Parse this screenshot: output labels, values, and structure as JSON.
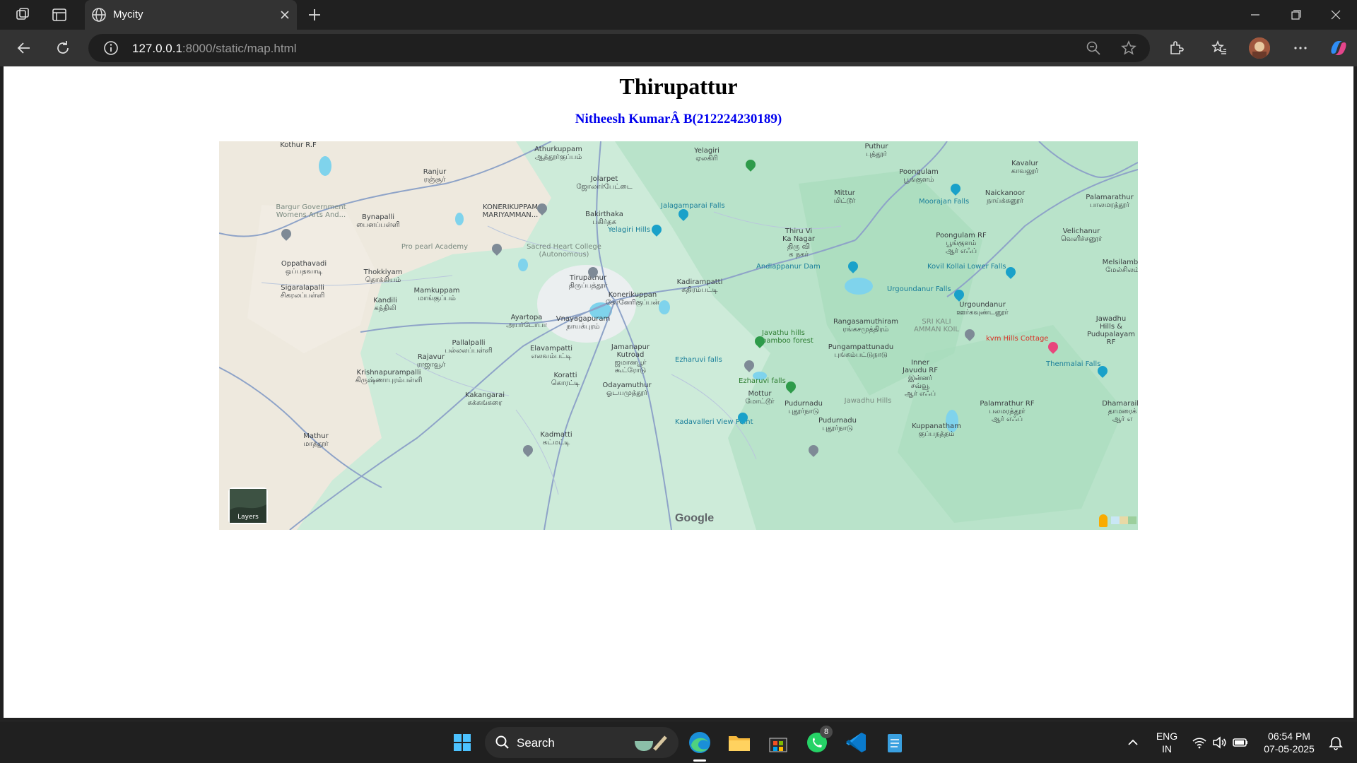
{
  "browser": {
    "tab_title": "Mycity",
    "url_host": "127.0.0.1",
    "url_rest": ":8000/static/map.html"
  },
  "page": {
    "title": "Thirupattur",
    "subtitle": "Nitheesh KumarÂ B(212224230189)"
  },
  "map": {
    "layers_label": "Layers",
    "google_label": "Google",
    "labels": {
      "kothur": "Kothur R.F",
      "athurkuppam": "Athurkuppam\nஆத்தூர்குப்பம்",
      "ranjur": "Ranjur\nரஞ்சூர்",
      "jolarpet": "Jolarpet\nஜோலார்பேட்டை",
      "yelagiri": "Yelagiri\nஏலகிரி",
      "puthur": "Puthur\nபுத்தூர்",
      "kavalur": "Kavalur\nகாவலூர்",
      "poongulam": "Poongulam\nபூங்குளம்",
      "naickanoor": "Naickanoor\nநாய்க்கனூர்",
      "palamarathur": "Palamarathur\nபாலமரத்தூர்",
      "bargur": "Bargur Government\nWomens Arts And...",
      "bynapalli": "Bynapalli\nபைனப்பள்ளி",
      "konerikuppam_m": "KONERIKUPPAM\nMARIYAMMAN...",
      "bakirthaka": "Bakirthaka\nபகிர்தக",
      "jalagamparai": "Jalagamparai Falls",
      "mittur": "Mittur\nமிட்டூர்",
      "moorajan": "Moorajan Falls",
      "yelagiri_hills": "Yelagiri Hills",
      "thiru_vi": "Thiru Vi\nKa Nagar\nதிரு வி\nக நகர்",
      "poongulam_rf": "Poongulam RF\nபூங்குளம்\nஆர் எஃப்",
      "velichanur": "Velichanur\nவெளிச்சனூர்",
      "pro_pearl": "Pro pearl Academy",
      "sacred_heart": "Sacred Heart College\n(Autonomous)",
      "oppathavadi": "Oppathavadi\nஒப்பதவாடி",
      "thokkiyam": "Thokkiyam\nதொக்கியம்",
      "andiappanur": "Andiappanur Dam",
      "kovil_kollai": "Kovil Kollai Lower Falls",
      "melsilamba": "Melsilamba\nமேல்சிலம்",
      "tirupathur": "Tirupathur\nதிருப்பத்தூர்",
      "kadirampatti": "Kadirampatti\nகதிரம்பட்டி",
      "sigaralapalli": "Sigaralapalli\nசிகரலப்பள்ளி",
      "mamkuppam": "Mamkuppam\nமாங்குப்பம்",
      "konerikuppan": "Konerikuppan\nகோனேரிகுப்பன்",
      "urgoundanur_falls": "Urgoundanur Falls",
      "kandili": "Kandili\nகந்திலி",
      "urgoundanur": "Urgoundanur\nஊர்கவுண்டனூர்",
      "ayartopa": "Ayartopa\nஅயர்டோபா",
      "vnayagapuram": "Vnayagapuram\nநாயக்புரம்",
      "rangasamuthiram": "Rangasamuthiram\nரங்கசமுத்திரம்",
      "sri_kali": "SRI KALI\nAMMAN KOIL",
      "jawadhu_rf": "Jawadhu\nHills &\nPudupalayam\nRF",
      "javathu_bamboo": "Javathu hills\nbamboo forest",
      "kvm_hills": "kvm Hills Cottage",
      "pallalpalli": "Pallalpalli\nபல்லலப்பள்ளி",
      "elavampatti": "Elavampatti\nஎலவம்பட்டி",
      "jamanapur": "Jamanapur\nKutroad\nஜமானபூர்\nகூட்ரோடு",
      "pungampattunadu": "Pungampattunadu\nபுங்கம்பட்டுநாடு",
      "rajavur": "Rajavur\nராஜாவூர்",
      "ezharuvi_falls": "Ezharuvi falls",
      "inner_javadu": "Inner\nJavudu RF\nஇன்னர்\nசவ்வூ\nஆர் எஃப்",
      "thenmalai": "Thenmalai Falls",
      "krishnapurampalli": "Krishnapurampalli\nகிருஷ்ணாபுரம்பள்ளி",
      "koratti": "Koratti\nகொரட்டி",
      "ezharuvi_falls2": "Ezharuvi falls",
      "odayamuthur": "Odayamuthur\nஓடயமுத்தூர்",
      "kakangarai": "Kakangarai\nகக்கங்கரை",
      "mottur": "Mottur\nமோட்டூர்",
      "pudurnadu": "Pudurnadu\nபுதூர்நாடு",
      "jawadhu_hills": "Jawadhu Hills",
      "palamrathur_rf": "Palamrathur RF\nபலமரத்தூர்\nஆர் எஃப்",
      "dhamaraikl": "Dhamaraikl\nதாமரைக்\nஆர் எ",
      "kadavalleri": "Kadavalleri View Point",
      "pudurnadu2": "Pudurnadu\nபுதூர்நாடு",
      "kuppanatham": "Kuppanatham\nகுப்பநத்தம்",
      "mathur": "Mathur\nமாத்தூர்",
      "kadmatti": "Kadmatti\nகட்மட்டி"
    },
    "colors": {
      "land": "#cdebd9",
      "urban": "#f1ece3",
      "road": "#8ea3c8",
      "water": "#7fd3ec",
      "park": "#a8dcbc",
      "hills": "#b7e2c9"
    }
  },
  "taskbar": {
    "search_label": "Search",
    "whatsapp_badge": "8",
    "lang_top": "ENG",
    "lang_bottom": "IN",
    "time": "06:54 PM",
    "date": "07-05-2025"
  }
}
